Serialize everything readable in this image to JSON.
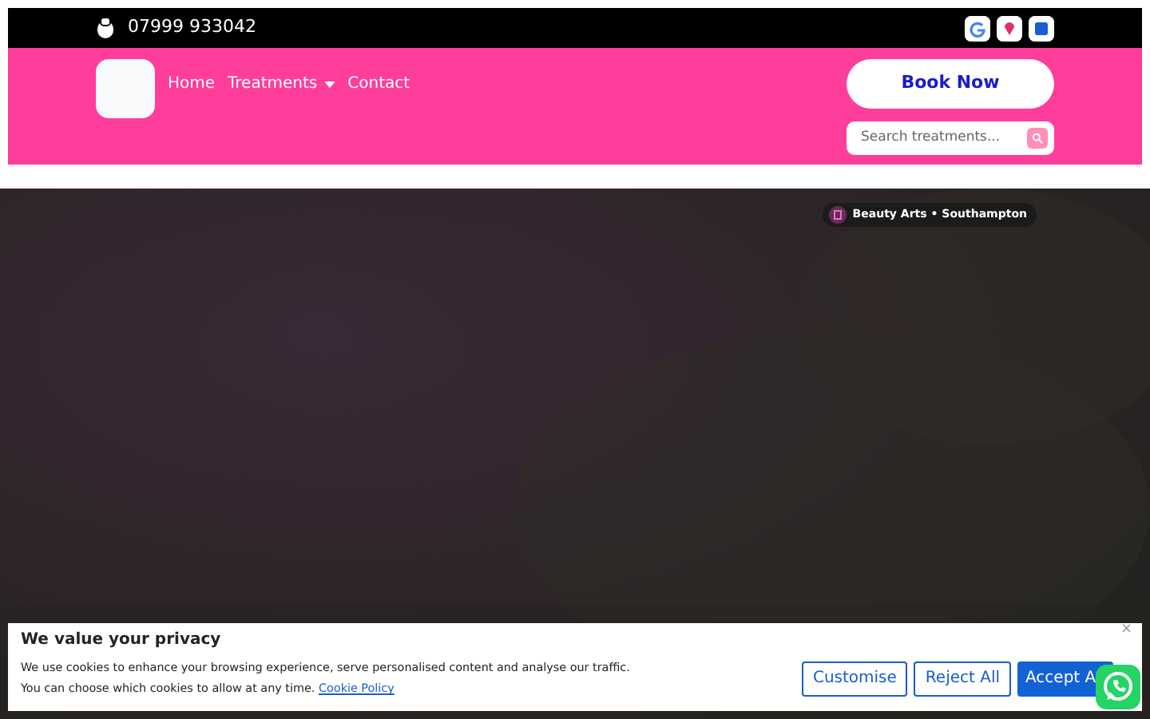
{
  "topbar": {
    "phone": "07999 933042"
  },
  "nav": {
    "links": [
      {
        "label": "Home",
        "kind": "link"
      },
      {
        "label": "Treatments",
        "kind": "dropdown"
      },
      {
        "label": "Contact",
        "kind": "link"
      }
    ],
    "book_button": "Book Now",
    "search": {
      "placeholder": "Search treatments..."
    }
  },
  "hero": {
    "kind": "picture",
    "badge": "Beauty Arts • Southampton"
  },
  "cookie_banner": {
    "title": "We value your privacy",
    "text": "We use cookies to enhance your browsing experience, serve personalised content and analyse our traffic.",
    "text2": "You can choose which cookies to allow at any time.",
    "link": "Cookie Policy",
    "close": "×",
    "buttons": [
      {
        "label": "Customise",
        "kind": "outline"
      },
      {
        "label": "Reject All",
        "kind": "outline"
      },
      {
        "label": "Accept A",
        "kind": "primary"
      }
    ]
  }
}
